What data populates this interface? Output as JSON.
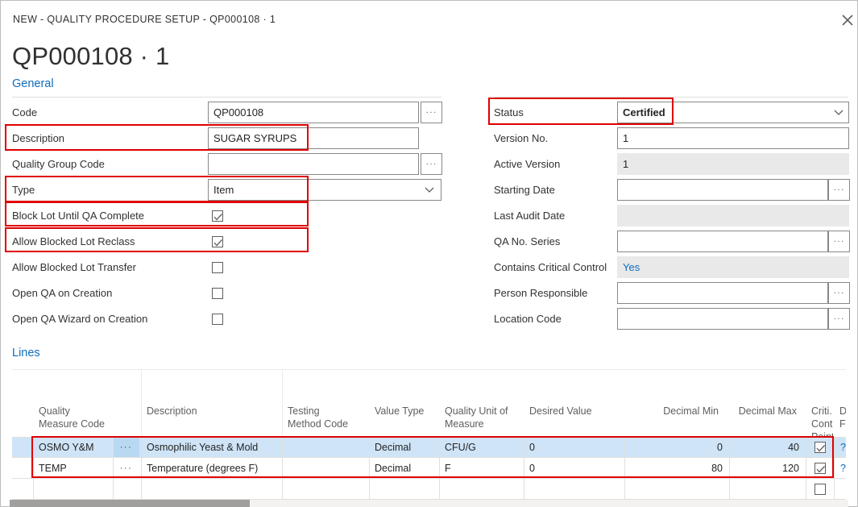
{
  "window": {
    "breadcrumb": "NEW  -  QUALITY PROCEDURE SETUP  -  QP000108 · 1",
    "close_label": "close-icon",
    "title": "QP000108 · 1"
  },
  "sections": {
    "general": "General",
    "lines": "Lines"
  },
  "general_left": [
    {
      "label": "Code",
      "value": "QP000108",
      "type": "text",
      "assist": true,
      "highlight": false
    },
    {
      "label": "Description",
      "value": "SUGAR SYRUPS",
      "type": "text",
      "assist": false,
      "highlight": true
    },
    {
      "label": "Quality Group Code",
      "value": "",
      "type": "text",
      "assist": true,
      "highlight": false
    },
    {
      "label": "Type",
      "value": "Item",
      "type": "dropdown",
      "assist": false,
      "highlight": true
    },
    {
      "label": "Block Lot Until QA Complete",
      "value": true,
      "type": "checkbox",
      "assist": false,
      "highlight": true
    },
    {
      "label": "Allow Blocked Lot Reclass",
      "value": true,
      "type": "checkbox",
      "assist": false,
      "highlight": true
    },
    {
      "label": "Allow Blocked Lot Transfer",
      "value": false,
      "type": "checkbox",
      "assist": false,
      "highlight": false
    },
    {
      "label": "Open QA on Creation",
      "value": false,
      "type": "checkbox",
      "assist": false,
      "highlight": false
    },
    {
      "label": "Open QA Wizard on Creation",
      "value": false,
      "type": "checkbox",
      "assist": false,
      "highlight": false
    }
  ],
  "general_right": [
    {
      "label": "Status",
      "value": "Certified",
      "type": "dropdown",
      "assist": false,
      "readonly": false,
      "bold": true,
      "link": false,
      "highlight": true
    },
    {
      "label": "Version No.",
      "value": "1",
      "type": "text",
      "assist": false,
      "readonly": false,
      "bold": false,
      "link": false,
      "highlight": false
    },
    {
      "label": "Active Version",
      "value": "1",
      "type": "text",
      "assist": false,
      "readonly": true,
      "bold": false,
      "link": false,
      "highlight": false
    },
    {
      "label": "Starting Date",
      "value": "",
      "type": "text",
      "assist": true,
      "readonly": false,
      "bold": false,
      "link": false,
      "highlight": false
    },
    {
      "label": "Last Audit Date",
      "value": "",
      "type": "text",
      "assist": false,
      "readonly": true,
      "bold": false,
      "link": false,
      "highlight": false
    },
    {
      "label": "QA No. Series",
      "value": "",
      "type": "text",
      "assist": true,
      "readonly": false,
      "bold": false,
      "link": false,
      "highlight": false
    },
    {
      "label": "Contains Critical Control",
      "value": "Yes",
      "type": "text",
      "assist": false,
      "readonly": true,
      "bold": false,
      "link": true,
      "highlight": false
    },
    {
      "label": "Person Responsible",
      "value": "",
      "type": "text",
      "assist": true,
      "readonly": false,
      "bold": false,
      "link": false,
      "highlight": false
    },
    {
      "label": "Location Code",
      "value": "",
      "type": "text",
      "assist": true,
      "readonly": false,
      "bold": false,
      "link": false,
      "highlight": false
    }
  ],
  "grid": {
    "columns": [
      {
        "header": "Quality\nMeasure Code",
        "align": "left"
      },
      {
        "header": "Description",
        "align": "left"
      },
      {
        "header": "Testing\nMethod Code",
        "align": "left"
      },
      {
        "header": "Value Type",
        "align": "left"
      },
      {
        "header": "Quality Unit of\nMeasure",
        "align": "left"
      },
      {
        "header": "Desired Value",
        "align": "left"
      },
      {
        "header": "Decimal Min",
        "align": "right"
      },
      {
        "header": "Decimal Max",
        "align": "right"
      },
      {
        "header": "Criti...\nContro\nPoint",
        "align": "left"
      },
      {
        "header": "D\nF",
        "align": "left"
      }
    ],
    "rows": [
      {
        "selected": true,
        "quality_measure_code": "OSMO Y&M",
        "description": "Osmophilic Yeast & Mold",
        "testing_method_code": "",
        "value_type": "Decimal",
        "quality_unit_of_measure": "CFU/G",
        "desired_value": "0",
        "decimal_min": "0",
        "decimal_max": "40",
        "critical_control_point": true,
        "trailing": "?"
      },
      {
        "selected": false,
        "quality_measure_code": "TEMP",
        "description": "Temperature (degrees F)",
        "testing_method_code": "",
        "value_type": "Decimal",
        "quality_unit_of_measure": "F",
        "desired_value": "0",
        "decimal_min": "80",
        "decimal_max": "120",
        "critical_control_point": true,
        "trailing": "?"
      },
      {
        "selected": false,
        "quality_measure_code": "",
        "description": "",
        "testing_method_code": "",
        "value_type": "",
        "quality_unit_of_measure": "",
        "desired_value": "",
        "decimal_min": "",
        "decimal_max": "",
        "critical_control_point": false,
        "trailing": ""
      }
    ],
    "drill_label": "···"
  },
  "colors": {
    "accent": "#0f6cbd",
    "highlight": "#e00000",
    "row_selected": "#cfe4f7",
    "readonly_bg": "#e9e9e9"
  }
}
